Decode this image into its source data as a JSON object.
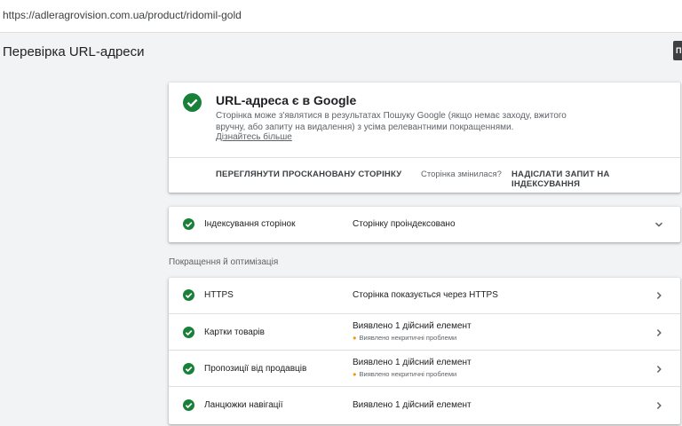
{
  "address_bar": {
    "url": "https://adleragrovision.com.ua/product/ridomil-gold"
  },
  "page": {
    "title": "Перевірка URL-адреси",
    "corner_button_label": "П"
  },
  "status": {
    "title": "URL-адреса є в Google",
    "description": "Сторінка може з'являтися в результатах Пошуку Google (якщо немає заходу, вжитого вручну, або запиту на видалення) з усіма релевантними покращеннями.",
    "learn_more": "Дізнайтесь більше",
    "view_crawled": "ПЕРЕГЛЯНУТИ ПРОСКАНОВАНУ СТОРІНКУ",
    "page_changed_question": "Сторінка змінилася?",
    "request_indexing": "НАДІСЛАТИ ЗАПИТ НА ІНДЕКСУВАННЯ"
  },
  "indexing": {
    "label": "Індексування сторінок",
    "value": "Сторінку проіндексовано",
    "chevron_icon": "chevron-down-icon"
  },
  "enhancements": {
    "section_title": "Покращення й оптимізація",
    "rows": [
      {
        "label": "HTTPS",
        "value": "Сторінка показується через HTTPS",
        "note": ""
      },
      {
        "label": "Картки товарів",
        "value": "Виявлено 1 дійсний елемент",
        "note": "Виявлено некритичні проблеми"
      },
      {
        "label": "Пропозиції від продавців",
        "value": "Виявлено 1 дійсний елемент",
        "note": "Виявлено некритичні проблеми"
      },
      {
        "label": "Ланцюжки навігації",
        "value": "Виявлено 1 дійсний елемент",
        "note": ""
      }
    ]
  },
  "colors": {
    "success": "#188038",
    "warning": "#f29900",
    "text": "#202124",
    "muted": "#5f6368",
    "background": "#f1f3f4"
  }
}
